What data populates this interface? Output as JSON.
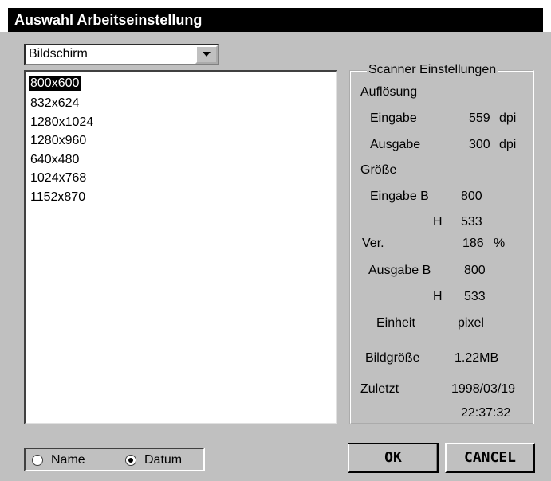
{
  "window": {
    "title": "Auswahl Arbeitseinstellung"
  },
  "dropdown": {
    "value": "Bildschirm"
  },
  "resolutions": [
    "800x600",
    "832x624",
    "1280x1024",
    "1280x960",
    "640x480",
    "1024x768",
    "1152x870"
  ],
  "selected_index": 0,
  "sort": {
    "name_label": "Name",
    "date_label": "Datum",
    "selected": "Datum"
  },
  "scanner": {
    "legend": "Scanner Einstellungen",
    "aufloesung": "Auflösung",
    "eingabe": "Eingabe",
    "eingabe_value": "559",
    "dpi1": "dpi",
    "ausgabe": "Ausgabe",
    "ausgabe_value": "300",
    "dpi2": "dpi",
    "groesse": "Größe",
    "eingabe_b_label": "Eingabe B",
    "eingabe_b_value": "800",
    "h_label": "H",
    "eingabe_h_value": "533",
    "ver_label": "Ver.",
    "ver_value": "186",
    "percent": "%",
    "ausgabe_b_label": "Ausgabe B",
    "ausgabe_b_value": "800",
    "ausgabe_h_label": "H",
    "ausgabe_h_value": "533",
    "einheit_label": "Einheit",
    "einheit_value": "pixel",
    "bildgroesse_label": "Bildgröße",
    "bildgroesse_value": "1.22MB",
    "zuletzt_label": "Zuletzt",
    "zuletzt_date": "1998/03/19",
    "zuletzt_time": "22:37:32"
  },
  "buttons": {
    "ok": "OK",
    "cancel": "CANCEL"
  }
}
